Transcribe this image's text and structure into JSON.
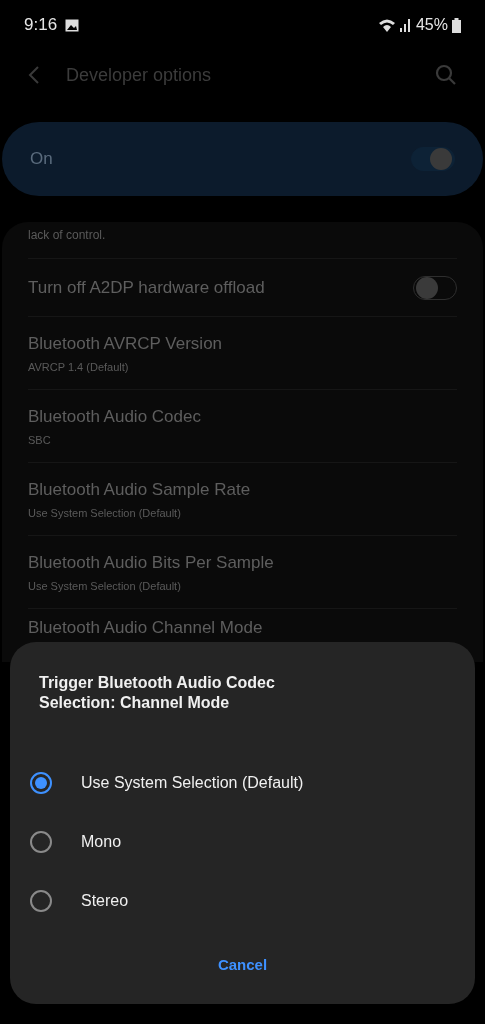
{
  "status_bar": {
    "time": "9:16",
    "battery": "45%"
  },
  "header": {
    "title": "Developer options"
  },
  "master_switch": {
    "label": "On",
    "on": true
  },
  "list": {
    "cut_text": "lack of control.",
    "items": [
      {
        "kind": "switch",
        "title": "Turn off A2DP hardware offload",
        "on": false
      },
      {
        "kind": "value",
        "title": "Bluetooth AVRCP Version",
        "value": "AVRCP 1.4 (Default)"
      },
      {
        "kind": "value",
        "title": "Bluetooth Audio Codec",
        "value": "SBC"
      },
      {
        "kind": "value",
        "title": "Bluetooth Audio Sample Rate",
        "value": "Use System Selection (Default)"
      },
      {
        "kind": "value",
        "title": "Bluetooth Audio Bits Per Sample",
        "value": "Use System Selection (Default)"
      },
      {
        "kind": "value",
        "title": "Bluetooth Audio Channel Mode"
      }
    ]
  },
  "dialog": {
    "title": "Trigger Bluetooth Audio Codec Selection: Channel Mode",
    "options": [
      {
        "label": "Use System Selection (Default)",
        "selected": true
      },
      {
        "label": "Mono",
        "selected": false
      },
      {
        "label": "Stereo",
        "selected": false
      }
    ],
    "button": "Cancel"
  }
}
